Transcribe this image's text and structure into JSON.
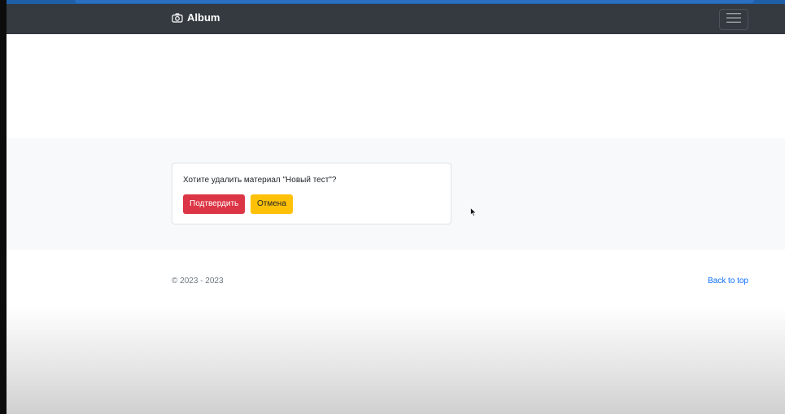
{
  "navbar": {
    "brand_label": "Album",
    "brand_icon": "camera-icon",
    "menu_icon": "hamburger-icon",
    "background": "#343a40"
  },
  "dialog": {
    "message": "Хотите удалить материал \"Новый тест\"?",
    "confirm_label": "Подтвердить",
    "cancel_label": "Отмена",
    "confirm_color": "#dc3545",
    "cancel_color": "#ffc107"
  },
  "footer": {
    "copyright": "© 2023 - 2023",
    "back_to_top": "Back to top",
    "link_color": "#0d6efd"
  }
}
